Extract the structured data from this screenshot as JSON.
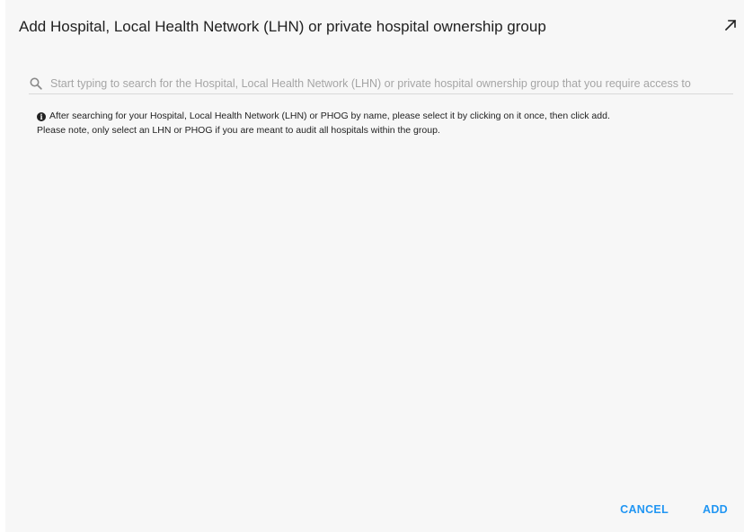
{
  "dialog": {
    "title": "Add Hospital, Local Health Network (LHN) or private hospital ownership group",
    "expand_icon": "arrow-up-right-icon"
  },
  "search": {
    "icon": "search-icon",
    "placeholder": "Start typing to search for the Hospital, Local Health Network (LHN) or private hospital ownership group that you require access to",
    "value": ""
  },
  "info": {
    "icon": "info-icon",
    "line1": "After searching for your Hospital, Local Health Network (LHN) or PHOG by name, please select it by clicking on it once, then click add.",
    "line2": "Please note, only select an LHN or PHOG if you are meant to audit all hospitals within the group."
  },
  "actions": {
    "cancel_label": "CANCEL",
    "add_label": "ADD"
  },
  "colors": {
    "accent": "#2196f3",
    "background": "#f7f7f7"
  }
}
